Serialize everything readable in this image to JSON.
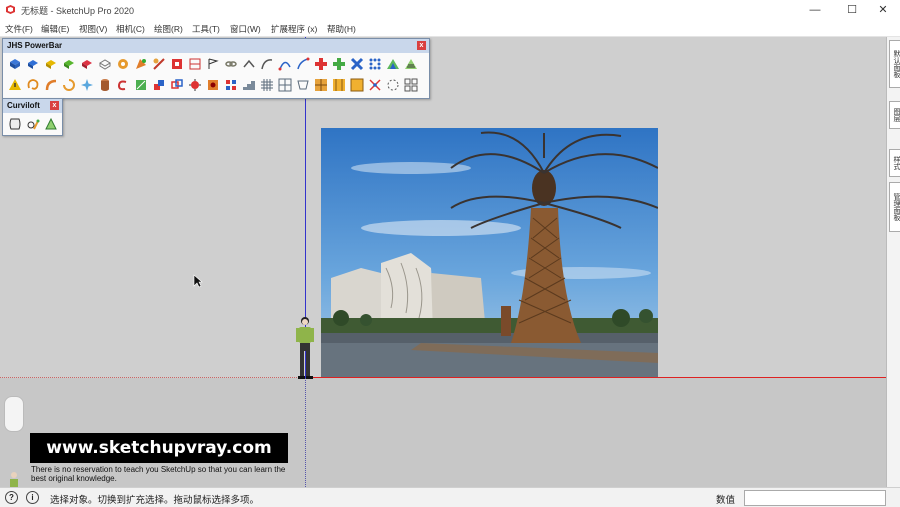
{
  "window": {
    "title": "无标题 - SketchUp Pro 2020",
    "controls": {
      "minimize": "—",
      "maximize": "☐",
      "close": "✕"
    }
  },
  "menu": [
    "文件(F)",
    "编辑(E)",
    "视图(V)",
    "相机(C)",
    "绘图(R)",
    "工具(T)",
    "窗口(W)",
    "扩展程序 (x)",
    "帮助(H)"
  ],
  "toolbars": {
    "powerbar": {
      "title": "JHS PowerBar",
      "close": "x"
    },
    "curviloft": {
      "title": "Curviloft",
      "close": "x"
    }
  },
  "right_tabs": [
    "默认面板",
    "图层",
    "样式",
    "管理面板"
  ],
  "watermark": {
    "url": "www.sketchupvray.com",
    "subtitle": "There is no reservation to teach you SketchUp so that you can learn the best original knowledge."
  },
  "status": {
    "message": "选择对象。切换到扩充选择。拖动鼠标选择多项。",
    "measurements_label": "数值",
    "measurements_value": ""
  },
  "colors": {
    "red_axis": "#dd2222",
    "blue_axis": "#3333cc",
    "green_axis": "#33aa33",
    "toolbar_header": "#c9d7eb",
    "sky": "#3f86cf"
  }
}
